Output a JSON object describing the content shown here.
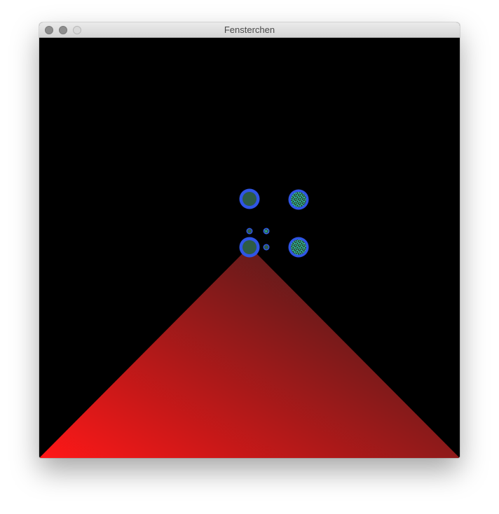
{
  "window": {
    "title": "Fensterchen"
  },
  "scene": {
    "background_color": "#000000",
    "triangle": {
      "color_left": "#ff1717",
      "color_right": "#3d1c1c"
    },
    "circles": {
      "ring_color": "#2f55e6",
      "fill_color": "#2e5c46",
      "noise_color": "#28e0c0"
    }
  }
}
